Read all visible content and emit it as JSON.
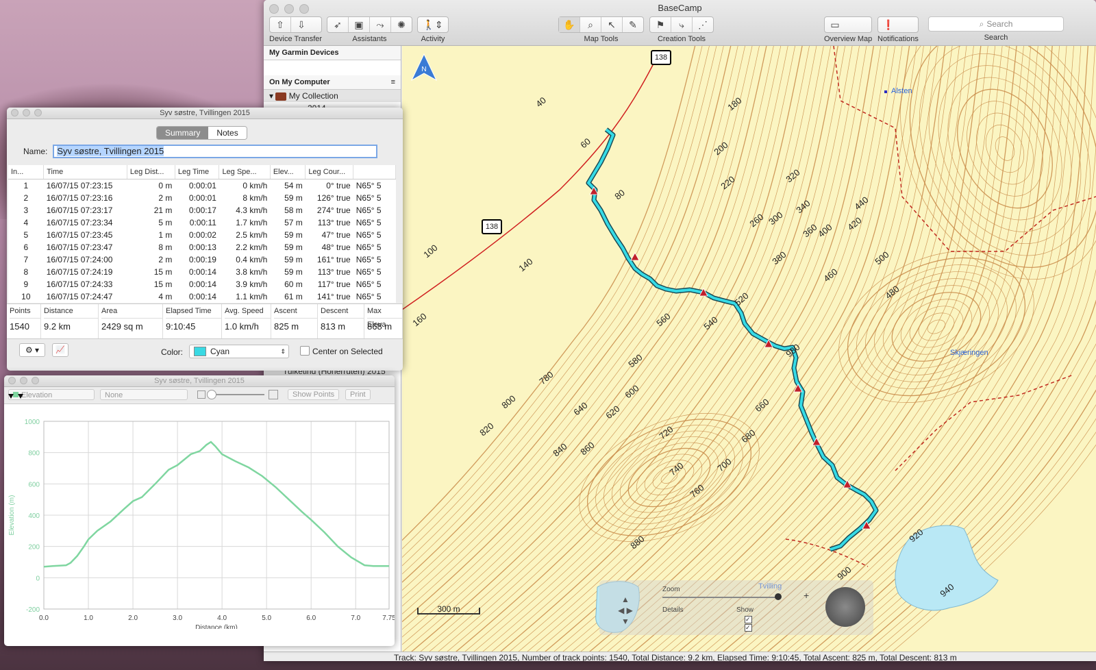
{
  "main_window": {
    "title": "BaseCamp",
    "toolbar": {
      "device_transfer": "Device Transfer",
      "assistants": "Assistants",
      "activity": "Activity",
      "map_tools": "Map Tools",
      "creation_tools": "Creation Tools",
      "overview_map": "Overview Map",
      "notifications": "Notifications",
      "search_placeholder": "Search",
      "search_label": "Search"
    },
    "sidebar": {
      "devices_header": "My Garmin Devices",
      "computer_header": "On My Computer",
      "collection": "My Collection",
      "year": "2014",
      "partial_item": "Tulketind (Honerruten) 2015"
    },
    "status": "Track: Syv søstre, Tvillingen 2015, Number of track points: 1540, Total Distance: 9.2 km, Elapsed Time: 9:10:45, Total Ascent: 825 m, Total Descent: 813 m"
  },
  "map": {
    "road_shields": [
      "138",
      "138"
    ],
    "places": [
      "Alsten",
      "Skjæringen",
      "Tvilling"
    ],
    "contour_labels": [
      "40",
      "60",
      "80",
      "100",
      "140",
      "160",
      "180",
      "200",
      "220",
      "260",
      "300",
      "320",
      "340",
      "360",
      "380",
      "400",
      "420",
      "440",
      "460",
      "480",
      "500",
      "520",
      "540",
      "560",
      "580",
      "600",
      "620",
      "640",
      "660",
      "680",
      "700",
      "720",
      "740",
      "760",
      "780",
      "800",
      "820",
      "840",
      "860",
      "880",
      "900",
      "920",
      "940",
      "980"
    ],
    "scale_label": "300 m",
    "controls": {
      "zoom": "Zoom",
      "details": "Details",
      "show": "Show"
    },
    "colors": {
      "land": "#fbf5c2",
      "contour": "#c88a48",
      "track": "#36dbe6",
      "water": "#b9e8f5",
      "road": "#d02020",
      "boundary": "#c0281e"
    }
  },
  "properties": {
    "title": "Syv søstre, Tvillingen 2015",
    "tabs": [
      "Summary",
      "Notes"
    ],
    "name_label": "Name:",
    "name_value": "Syv søstre, Tvillingen 2015",
    "columns": [
      "In...",
      "Time",
      "Leg Dist...",
      "Leg Time",
      "Leg Spe...",
      "Elev...",
      "Leg Cour...",
      ""
    ],
    "rows": [
      [
        "1",
        "16/07/15 07:23:15",
        "0 m",
        "0:00:01",
        "0 km/h",
        "54 m",
        "0° true",
        "N65° 5"
      ],
      [
        "2",
        "16/07/15 07:23:16",
        "2 m",
        "0:00:01",
        "8 km/h",
        "59 m",
        "126° true",
        "N65° 5"
      ],
      [
        "3",
        "16/07/15 07:23:17",
        "21 m",
        "0:00:17",
        "4.3 km/h",
        "58 m",
        "274° true",
        "N65° 5"
      ],
      [
        "4",
        "16/07/15 07:23:34",
        "5 m",
        "0:00:11",
        "1.7 km/h",
        "57 m",
        "113° true",
        "N65° 5"
      ],
      [
        "5",
        "16/07/15 07:23:45",
        "1 m",
        "0:00:02",
        "2.5 km/h",
        "59 m",
        "47° true",
        "N65° 5"
      ],
      [
        "6",
        "16/07/15 07:23:47",
        "8 m",
        "0:00:13",
        "2.2 km/h",
        "59 m",
        "48° true",
        "N65° 5"
      ],
      [
        "7",
        "16/07/15 07:24:00",
        "2 m",
        "0:00:19",
        "0.4 km/h",
        "59 m",
        "161° true",
        "N65° 5"
      ],
      [
        "8",
        "16/07/15 07:24:19",
        "15 m",
        "0:00:14",
        "3.8 km/h",
        "59 m",
        "113° true",
        "N65° 5"
      ],
      [
        "9",
        "16/07/15 07:24:33",
        "15 m",
        "0:00:14",
        "3.9 km/h",
        "60 m",
        "117° true",
        "N65° 5"
      ],
      [
        "10",
        "16/07/15 07:24:47",
        "4 m",
        "0:00:14",
        "1.1 km/h",
        "61 m",
        "141° true",
        "N65° 5"
      ]
    ],
    "stats_headers": [
      "Points",
      "Distance",
      "Area",
      "Elapsed Time",
      "Avg. Speed",
      "Ascent",
      "Descent",
      "Max Eleva"
    ],
    "stats_values": [
      "1540",
      "9.2 km",
      "2429 sq m",
      "9:10:45",
      "1.0 km/h",
      "825 m",
      "813 m",
      "868 m"
    ],
    "color_label": "Color:",
    "color_value": "Cyan",
    "center_label": "Center on Selected"
  },
  "elevation": {
    "title": "Syv søstre, Tvillingen 2015",
    "dropdown1": "Elevation",
    "dropdown2": "None",
    "show_points": "Show Points",
    "print": "Print"
  },
  "chart_data": {
    "type": "line",
    "title": "",
    "xlabel": "Distance (km)",
    "ylabel": "Elevation (m)",
    "xlim": [
      0,
      7.75
    ],
    "ylim": [
      -200,
      1000
    ],
    "xticks": [
      "0.0",
      "1.0",
      "2.0",
      "3.0",
      "4.0",
      "5.0",
      "6.0",
      "7.0",
      "7.75"
    ],
    "yticks": [
      "-200",
      "0",
      "200",
      "400",
      "600",
      "800",
      "1000"
    ],
    "grid": true,
    "line_color": "#7fd6a0",
    "series": [
      {
        "x": [
          0,
          0.2,
          0.5,
          0.6,
          0.75,
          0.9,
          1.0,
          1.2,
          1.5,
          1.8,
          2.0,
          2.2,
          2.5,
          2.8,
          3.0,
          3.3,
          3.5,
          3.65,
          3.75,
          3.85,
          4.0,
          4.3,
          4.6,
          4.9,
          5.2,
          5.5,
          5.8,
          6.0,
          6.3,
          6.6,
          6.9,
          7.2,
          7.4,
          7.6,
          7.75
        ],
        "y": [
          70,
          75,
          80,
          95,
          140,
          200,
          245,
          300,
          360,
          440,
          490,
          515,
          600,
          690,
          720,
          790,
          810,
          850,
          868,
          840,
          790,
          745,
          705,
          650,
          580,
          500,
          420,
          370,
          290,
          200,
          130,
          80,
          75,
          75,
          75
        ]
      }
    ]
  }
}
